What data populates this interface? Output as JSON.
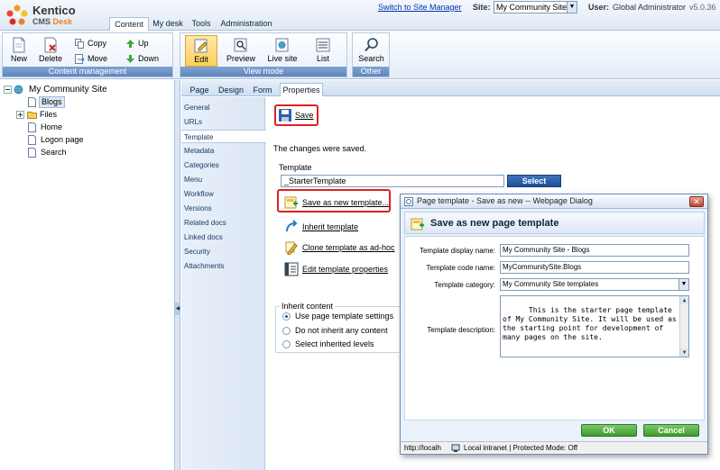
{
  "header": {
    "brand": "Kentico",
    "product": "CMS",
    "product_accent": "Desk",
    "tabs": [
      {
        "label": "Content",
        "active": true
      },
      {
        "label": "My desk",
        "active": false
      },
      {
        "label": "Tools",
        "active": false
      },
      {
        "label": "Administration",
        "active": false
      }
    ],
    "switch_link": "Switch to Site Manager",
    "site_label": "Site:",
    "site_value": "My Community Site",
    "user_label": "User:",
    "user_value": "Global Administrator",
    "version": "v5.0.36"
  },
  "ribbon": {
    "content_mgmt": {
      "title": "Content management",
      "new_label": "New",
      "delete_label": "Delete",
      "copy_label": "Copy",
      "move_label": "Move",
      "up_label": "Up",
      "down_label": "Down"
    },
    "view_mode": {
      "title": "View mode",
      "edit_label": "Edit",
      "preview_label": "Preview",
      "live_label": "Live site",
      "list_label": "List"
    },
    "other": {
      "title": "Other",
      "search_label": "Search"
    }
  },
  "tree": {
    "root": "My Community Site",
    "items": [
      "Blogs",
      "Files",
      "Home",
      "Logon page",
      "Search"
    ]
  },
  "subtabs": [
    {
      "label": "Page",
      "active": false
    },
    {
      "label": "Design",
      "active": false
    },
    {
      "label": "Form",
      "active": false
    },
    {
      "label": "Properties",
      "active": true
    }
  ],
  "vnav": [
    "General",
    "URLs",
    "Template",
    "Metadata",
    "Categories",
    "Menu",
    "Workflow",
    "Versions",
    "Related docs",
    "Linked docs",
    "Security",
    "Attachments"
  ],
  "vnav_active": "Template",
  "page": {
    "save_label": "Save",
    "saved_message": "The changes were saved.",
    "template_legend": "Template",
    "template_value": "_StarterTemplate",
    "select_label": "Select",
    "actions": {
      "save_new": "Save as new template...",
      "inherit": "Inherit template",
      "clone": "Clone template as ad-hoc",
      "edit_props": "Edit template properties"
    },
    "inherit_legend": "Inherit content",
    "inherit_options": [
      "Use page template settings",
      "Do not inherit any content",
      "Select inherited levels"
    ]
  },
  "dialog": {
    "window_title": "Page template - Save as new -- Webpage Dialog",
    "heading": "Save as new page template",
    "display_name_label": "Template display name:",
    "display_name_value": "My Community Site - Blogs",
    "code_name_label": "Template code name:",
    "code_name_value": "MyCommunitySite.Blogs",
    "category_label": "Template category:",
    "category_value": "My Community Site templates",
    "description_label": "Template description:",
    "description_value": "This is the starter page template of My Community Site. It will be used as the starting point for development of many pages on the site.",
    "ok_label": "OK",
    "cancel_label": "Cancel",
    "status_url": "http://localh",
    "status_zone": "Local intranet | Protected Mode: Off"
  },
  "colors": {
    "accent_blue": "#1e4f95",
    "highlight_red": "#e02020",
    "ok_green": "#3e9a2c"
  }
}
